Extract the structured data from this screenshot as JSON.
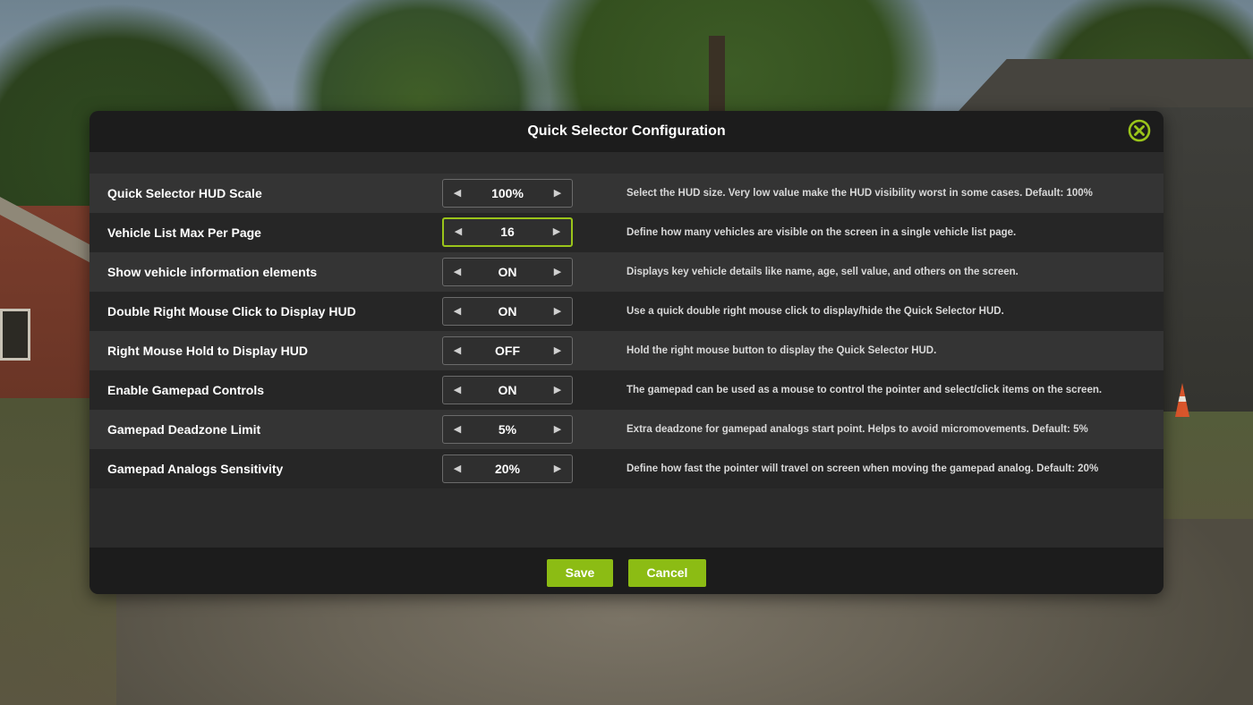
{
  "dialog": {
    "title": "Quick Selector Configuration",
    "accent_color": "#9ac41a",
    "close_icon": "close-circle-icon"
  },
  "settings": [
    {
      "label": "Quick Selector HUD Scale",
      "value": "100%",
      "description": "Select the HUD size. Very low value make the HUD visibility worst in some cases. Default: 100%",
      "active": false
    },
    {
      "label": "Vehicle List Max Per Page",
      "value": "16",
      "description": "Define how many vehicles are visible on the screen in a single vehicle list page.",
      "active": true
    },
    {
      "label": "Show vehicle information elements",
      "value": "ON",
      "description": "Displays key vehicle details like name, age, sell value, and others on the screen.",
      "active": false
    },
    {
      "label": "Double Right Mouse Click to Display HUD",
      "value": "ON",
      "description": "Use a quick double right mouse click to display/hide the Quick Selector HUD.",
      "active": false
    },
    {
      "label": "Right Mouse Hold to Display HUD",
      "value": "OFF",
      "description": "Hold the right mouse button to display the Quick Selector HUD.",
      "active": false
    },
    {
      "label": "Enable Gamepad Controls",
      "value": "ON",
      "description": "The gamepad can be used as a mouse to control the pointer and select/click items on the screen.",
      "active": false
    },
    {
      "label": "Gamepad Deadzone Limit",
      "value": "5%",
      "description": "Extra deadzone for gamepad analogs start point. Helps to avoid micromovements. Default: 5%",
      "active": false
    },
    {
      "label": "Gamepad Analogs Sensitivity",
      "value": "20%",
      "description": "Define how fast the pointer will travel on screen when moving the gamepad analog. Default: 20%",
      "active": false
    }
  ],
  "arrows": {
    "left": "◀",
    "right": "▶"
  },
  "footer": {
    "save_label": "Save",
    "cancel_label": "Cancel",
    "button_color": "#8cbc14"
  }
}
